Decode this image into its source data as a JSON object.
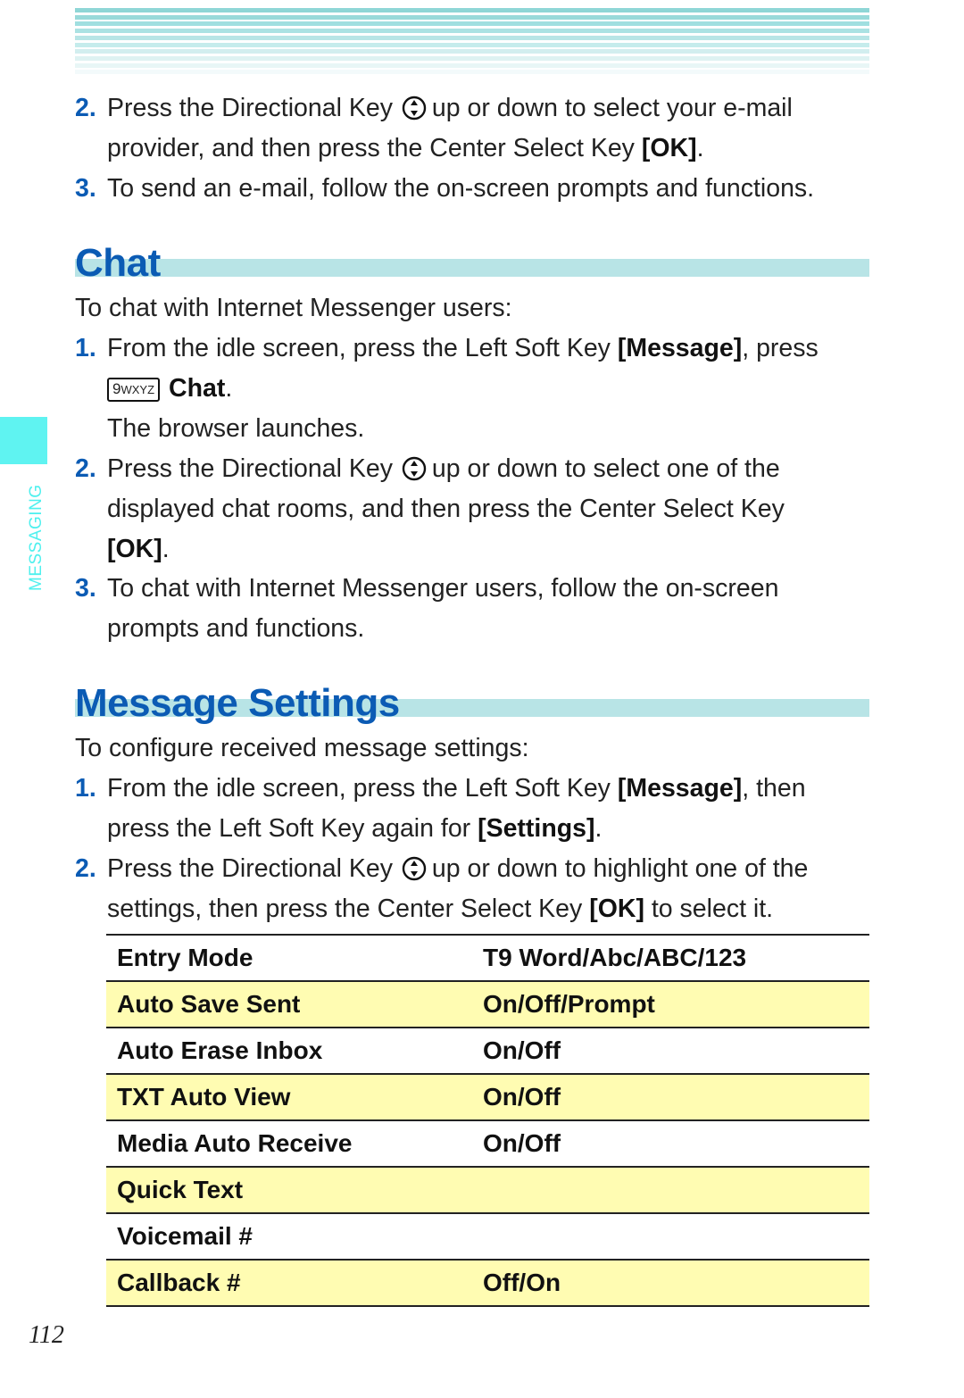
{
  "page": {
    "section_tab": "MESSAGING",
    "page_number": "112",
    "colors": {
      "accent_blue": "#0b5bb4",
      "heading_bar": "#b8e4e6",
      "side_tab": "#5ff3f1",
      "row_highlight": "#fffcb2"
    }
  },
  "intro_steps": [
    {
      "num": "2.",
      "line1_a": "Press the Directional Key",
      "icon": "directional-key-icon",
      "line1_b": "up or down to select your e-mail",
      "line2_a": "provider, and then press the Center Select Key ",
      "line2_bold": "[OK]",
      "line2_b": "."
    },
    {
      "num": "3.",
      "text": "To send an e-mail, follow the on-screen prompts and functions."
    }
  ],
  "chat": {
    "title": "Chat",
    "intro": "To chat with Internet Messenger users:",
    "step1": {
      "num": "1.",
      "a": "From the idle screen, press the Left Soft Key ",
      "bold": "[Message]",
      "b": ", press",
      "key_digit": "9",
      "key_letters": "WXYZ",
      "key_label": "Chat",
      "key_after": ".",
      "result": "The browser launches."
    },
    "step2": {
      "num": "2.",
      "a": "Press the Directional Key",
      "b": "up or down to select one of the",
      "line2": "displayed chat rooms, and then press the Center Select Key",
      "line3_bold": "[OK]",
      "line3_after": "."
    },
    "step3": {
      "num": "3.",
      "line1": "To chat with Internet Messenger users, follow the on-screen",
      "line2": "prompts and functions."
    }
  },
  "settings": {
    "title": "Message Settings",
    "intro": "To configure received message settings:",
    "step1": {
      "num": "1.",
      "a": "From the idle screen, press the Left Soft Key ",
      "bold": "[Message]",
      "b": ", then",
      "line2_a": "press the Left Soft Key again for ",
      "line2_bold": "[Settings]",
      "line2_b": "."
    },
    "step2": {
      "num": "2.",
      "a": "Press the Directional Key",
      "b": "up or down to highlight one of the",
      "line2_a": "settings, then press the Center Select Key ",
      "line2_bold": "[OK]",
      "line2_b": " to select it."
    },
    "table": [
      {
        "name": "Entry Mode",
        "value": "T9 Word/Abc/ABC/123",
        "highlight": false
      },
      {
        "name": "Auto Save Sent",
        "value": "On/Off/Prompt",
        "highlight": true
      },
      {
        "name": "Auto Erase Inbox",
        "value": "On/Off",
        "highlight": false
      },
      {
        "name": "TXT Auto View",
        "value": "On/Off",
        "highlight": true
      },
      {
        "name": "Media Auto Receive",
        "value": "On/Off",
        "highlight": false
      },
      {
        "name": "Quick Text",
        "value": "",
        "highlight": true
      },
      {
        "name": "Voicemail #",
        "value": "",
        "highlight": false
      },
      {
        "name": "Callback #",
        "value": "Off/On",
        "highlight": true
      }
    ]
  }
}
